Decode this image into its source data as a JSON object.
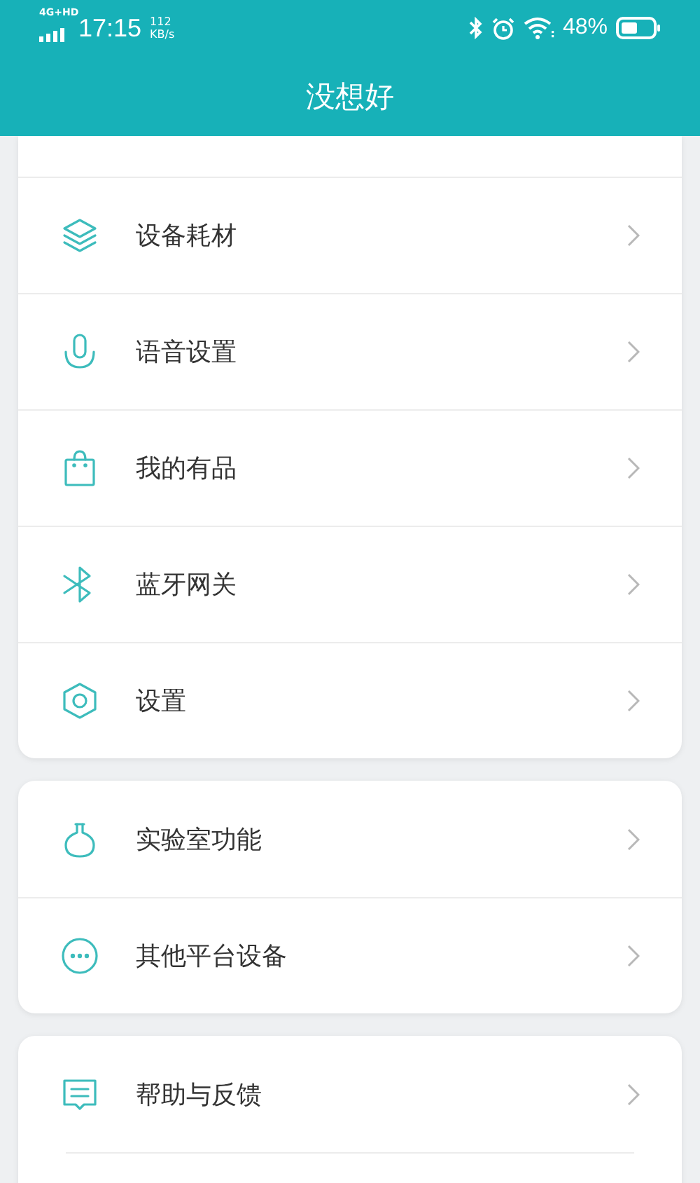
{
  "status_bar": {
    "network": "4G+HD",
    "time": "17:15",
    "speed_value": "112",
    "speed_unit": "KB/s",
    "battery": "48%"
  },
  "header": {
    "title": "没想好"
  },
  "sections": [
    {
      "top_cut": true,
      "items": [
        {
          "label": "设备耗材",
          "kind": "layers"
        },
        {
          "label": "语音设置",
          "kind": "mic"
        },
        {
          "label": "我的有品",
          "kind": "bag"
        },
        {
          "label": "蓝牙网关",
          "kind": "bluetooth"
        },
        {
          "label": "设置",
          "kind": "hexagon"
        }
      ]
    },
    {
      "top_cut": false,
      "items": [
        {
          "label": "实验室功能",
          "kind": "flask"
        },
        {
          "label": "其他平台设备",
          "kind": "more"
        }
      ]
    },
    {
      "top_cut": false,
      "bottom_cut": true,
      "items": [
        {
          "label": "帮助与反馈",
          "kind": "message"
        }
      ]
    }
  ]
}
